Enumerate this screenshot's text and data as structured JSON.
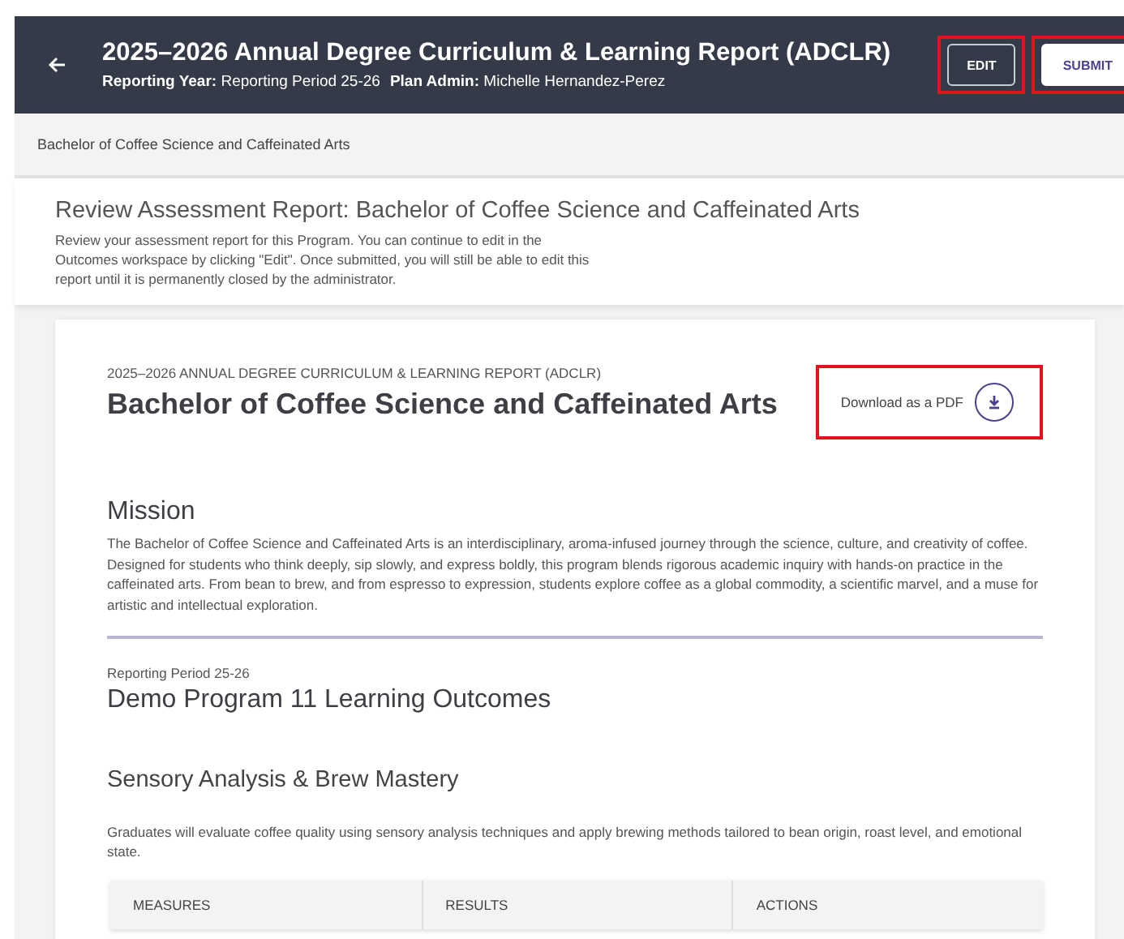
{
  "header": {
    "title": "2025–2026 Annual Degree Curriculum & Learning Report (ADCLR)",
    "meta": [
      {
        "label": "Reporting Year:",
        "value": "Reporting Period 25-26"
      },
      {
        "label": "Plan Admin:",
        "value": "Michelle Hernandez-Perez"
      }
    ],
    "buttons": [
      {
        "label": "EDIT",
        "kind": "outline",
        "highlighted": true
      },
      {
        "label": "SUBMIT",
        "kind": "filled",
        "highlighted": true
      }
    ]
  },
  "breadcrumb": "Bachelor of Coffee Science and Caffeinated Arts",
  "intro": {
    "title": "Review Assessment Report: Bachelor of Coffee Science and Caffeinated Arts",
    "text": "Review your assessment report for this Program. You can continue to edit in the Outcomes workspace by clicking \"Edit\". Once submitted, you will still be able to edit this report until it is permanently closed by the administrator."
  },
  "report": {
    "eyebrow": "2025–2026 ANNUAL DEGREE CURRICULUM & LEARNING REPORT (ADCLR)",
    "title": "Bachelor of Coffee Science and Caffeinated Arts",
    "download": {
      "label": "Download as a PDF",
      "highlighted": true
    },
    "mission": {
      "heading": "Mission",
      "text": "The Bachelor of Coffee Science and Caffeinated Arts is an interdisciplinary, aroma-infused journey through the science, culture, and creativity of coffee. Designed for students who think deeply, sip slowly, and express boldly, this program blends rigorous academic inquiry with hands-on practice in the caffeinated arts. From bean to brew, and from espresso to expression, students explore coffee as a global commodity, a scientific marvel, and a muse for artistic and intellectual exploration."
    },
    "period": "Reporting Period 25-26",
    "program_title": "Demo Program 11 Learning Outcomes",
    "outcome": {
      "title": "Sensory Analysis & Brew Mastery",
      "text": "Graduates will evaluate coffee quality using sensory analysis techniques and apply brewing methods tailored to bean origin, roast level, and emotional state."
    },
    "table": {
      "columns": [
        "MEASURES",
        "RESULTS",
        "ACTIONS"
      ]
    }
  }
}
